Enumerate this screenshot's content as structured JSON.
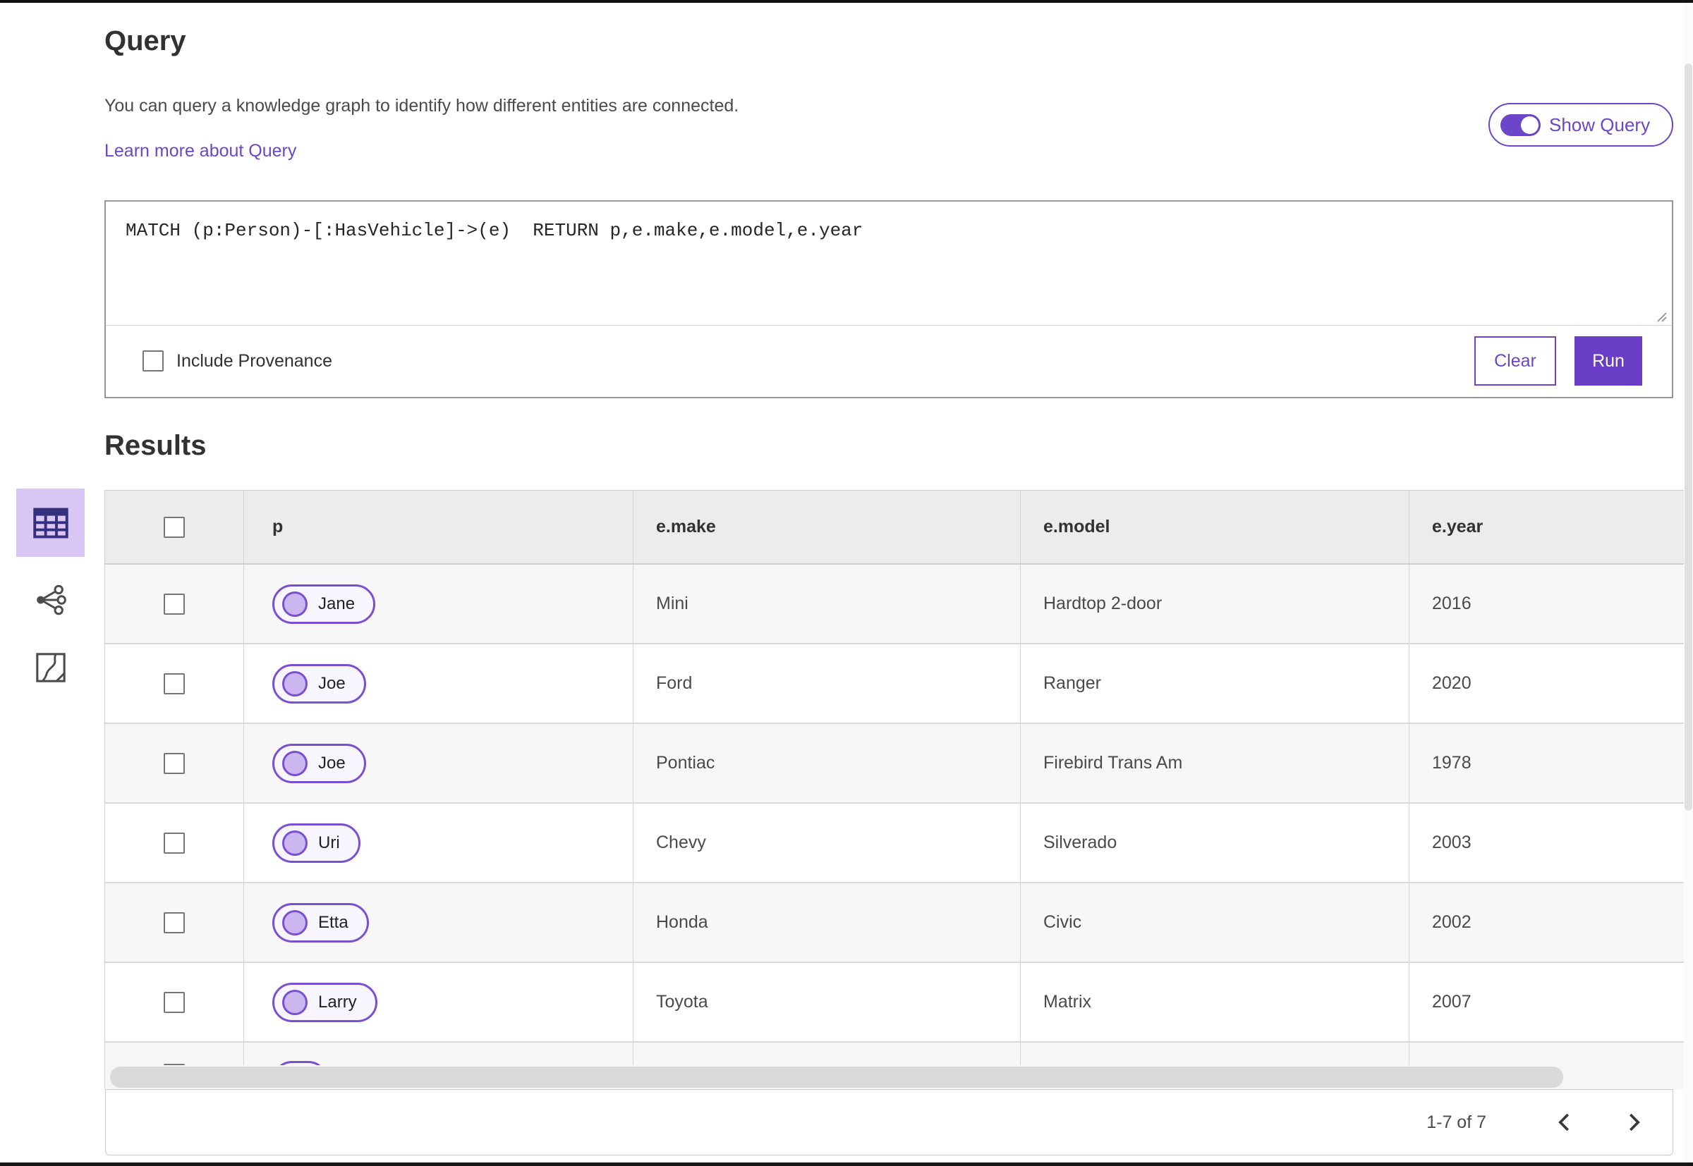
{
  "header": {
    "title": "Query",
    "description": "You can query a knowledge graph to identify how different entities are connected.",
    "learn_more_label": "Learn more about Query",
    "show_query_label": "Show Query",
    "show_query_state": "on"
  },
  "query_panel": {
    "query_text": "MATCH (p:Person)-[:HasVehicle]->(e)  RETURN p,e.make,e.model,e.year",
    "include_provenance_label": "Include Provenance",
    "include_provenance_checked": false,
    "clear_label": "Clear",
    "run_label": "Run"
  },
  "view_sidebar": {
    "items": [
      {
        "icon": "table-icon",
        "selected": true
      },
      {
        "icon": "link-chart-icon",
        "selected": false
      },
      {
        "icon": "map-icon",
        "selected": false
      }
    ]
  },
  "results": {
    "title": "Results",
    "columns": [
      "p",
      "e.make",
      "e.model",
      "e.year"
    ],
    "rows": [
      {
        "p": "Jane",
        "make": "Mini",
        "model": "Hardtop 2-door",
        "year": "2016"
      },
      {
        "p": "Joe",
        "make": "Ford",
        "model": "Ranger",
        "year": "2020"
      },
      {
        "p": "Joe",
        "make": "Pontiac",
        "model": "Firebird Trans Am",
        "year": "1978"
      },
      {
        "p": "Uri",
        "make": "Chevy",
        "model": "Silverado",
        "year": "2003"
      },
      {
        "p": "Etta",
        "make": "Honda",
        "model": "Civic",
        "year": "2002"
      },
      {
        "p": "Larry",
        "make": "Toyota",
        "model": "Matrix",
        "year": "2007"
      }
    ],
    "partial_row_visible": true,
    "pagination": {
      "range_label": "1-7 of 7",
      "prev_icon": "chevron-left-icon",
      "next_icon": "chevron-right-icon"
    }
  },
  "colors": {
    "accent_purple": "#6B46C8",
    "run_button": "#6A3DC6",
    "selected_view_background": "#D9C6F4",
    "pill_border": "#7950D2",
    "pill_circle_fill": "#CBB6F0",
    "header_row_background": "#ECECEC",
    "alt_row_background": "#F7F7F7"
  }
}
